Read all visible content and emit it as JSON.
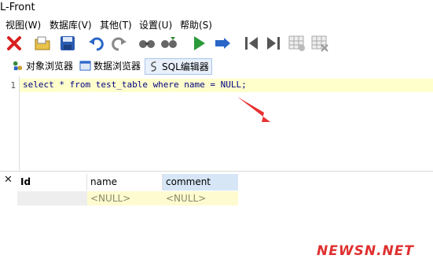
{
  "window": {
    "title": "L-Front"
  },
  "menu": [
    "视图(W)",
    "数据库(V)",
    "其他(T)",
    "设置(U)",
    "帮助(S)"
  ],
  "toolbar_icons": [
    "close-x-icon",
    "open-folder-icon",
    "save-icon",
    "undo-icon",
    "redo-icon",
    "find-icon",
    "find-replace-icon",
    "run-icon",
    "run-step-icon",
    "first-record-icon",
    "last-record-icon",
    "grid-add-icon",
    "grid-delete-icon"
  ],
  "tabs": [
    {
      "label": "对象浏览器",
      "icon": "object-browser-icon",
      "active": false
    },
    {
      "label": "数据浏览器",
      "icon": "data-browser-icon",
      "active": false
    },
    {
      "label": "SQL编辑器",
      "icon": "sql-editor-icon",
      "active": true
    }
  ],
  "editor": {
    "line_number": "1",
    "code": "select * from test_table where name = NULL;"
  },
  "results": {
    "columns": [
      "Id",
      "name",
      "comment"
    ],
    "rows": [
      [
        "",
        "<NULL>",
        "<NULL>"
      ]
    ]
  },
  "watermark": "NEWSN.NET",
  "colors": {
    "accent": "#e03030",
    "current_line": "#ffffcc",
    "selected_header": "#d6e6f7",
    "null_cell": "#fffbd0"
  }
}
